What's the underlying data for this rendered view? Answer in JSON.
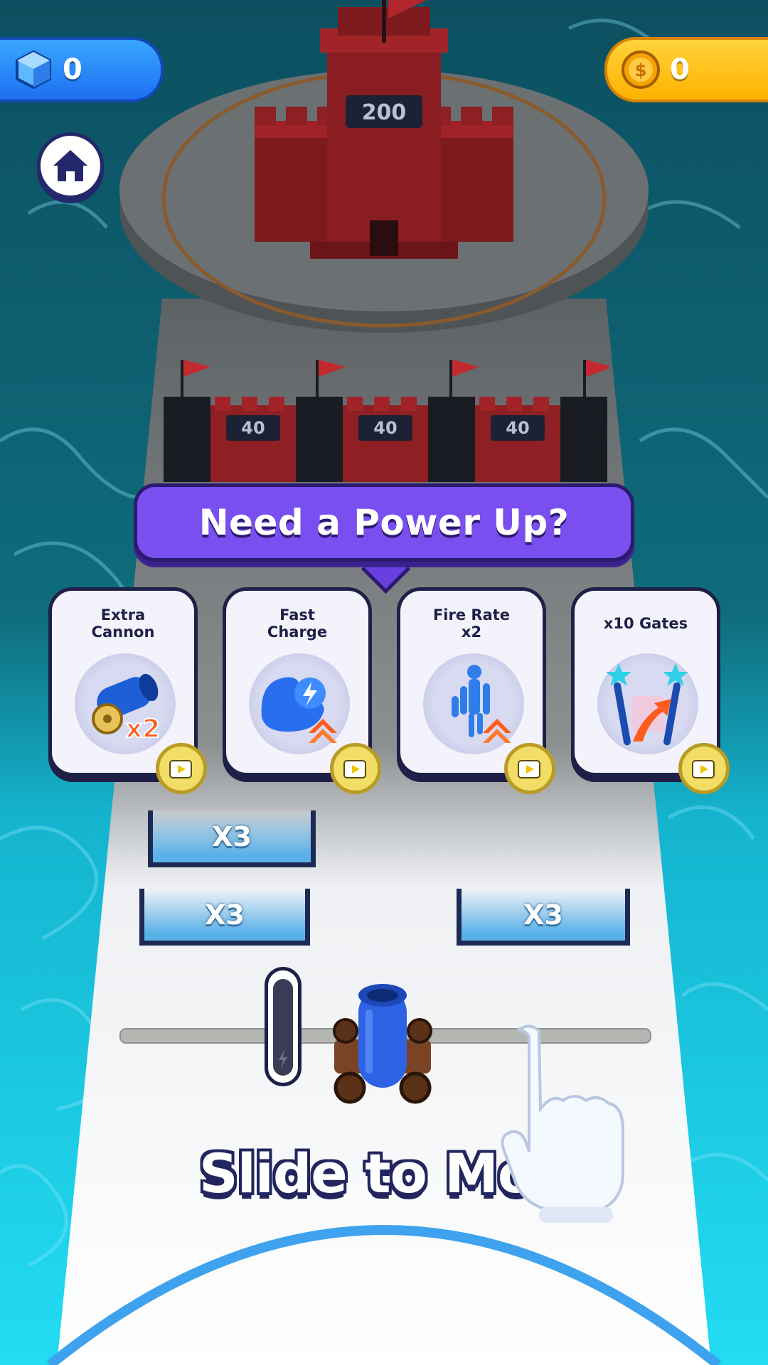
{
  "hud": {
    "gems": "0",
    "coins": "0"
  },
  "icons": {
    "gem": "gem-cube-icon",
    "coin": "gold-coin-icon",
    "home": "home-icon",
    "ad": "video-ad-icon"
  },
  "castle": {
    "main_hp": "200",
    "walls": [
      {
        "hp": "40"
      },
      {
        "hp": "40"
      },
      {
        "hp": "40"
      }
    ]
  },
  "powerup": {
    "title": "Need a Power Up?",
    "cards": [
      {
        "label_line1": "Extra",
        "label_line2": "Cannon",
        "icon": "cannon-x2-icon"
      },
      {
        "label_line1": "Fast",
        "label_line2": "Charge",
        "icon": "flexed-arm-bolt-icon"
      },
      {
        "label_line1": "Fire Rate",
        "label_line2": "x2",
        "icon": "fire-rate-figure-icon"
      },
      {
        "label_line1": "x10 Gates",
        "label_line2": "",
        "icon": "magic-wands-icon"
      }
    ]
  },
  "gates": [
    {
      "label": "X3"
    },
    {
      "label": "X3"
    },
    {
      "label": "X3"
    }
  ],
  "cannon_badge": "x2",
  "tutorial": {
    "text": "Slide to Mov"
  },
  "colors": {
    "water_deep": "#0f5e6e",
    "water_shallow": "#1fd6f0",
    "road": "#f7f8fb",
    "castle": "#a01f23",
    "banner": "#7a4ff0",
    "gem_pill": "#2a86f7",
    "coin_pill": "#ffc21a",
    "gate": "#5ab1e8",
    "cannon": "#2e63e6"
  }
}
